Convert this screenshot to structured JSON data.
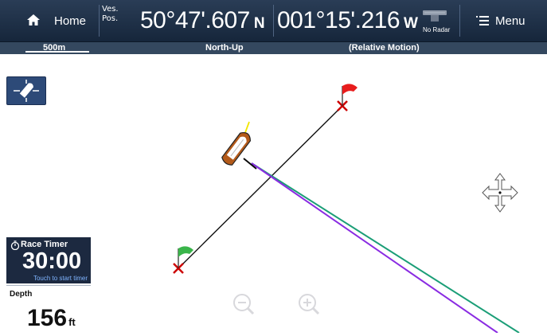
{
  "topbar": {
    "home_label": "Home",
    "ves_pos_label": "Ves.\nPos.",
    "latitude": "50°47'.607",
    "latitude_hemisphere": "N",
    "longitude": "001°15'.216",
    "longitude_hemisphere": "W",
    "radar_label": "No Radar",
    "menu_label": "Menu"
  },
  "statusbar": {
    "scale": "500m",
    "orientation": "North-Up",
    "motion_mode": "(Relative Motion)"
  },
  "race_timer": {
    "title": "Race Timer",
    "value": "30:00",
    "hint": "Touch to start timer"
  },
  "depth": {
    "title": "Depth",
    "value": "156",
    "unit": "ft"
  },
  "colors": {
    "topbar": "#1e2f46",
    "track_green": "#1b9e77",
    "track_purple": "#8a2be2",
    "flag_red": "#e81d1d",
    "flag_green": "#3ab54a",
    "mark_cross": "#cc0000",
    "heading_line": "#f2e600"
  },
  "icons": [
    "home-icon",
    "menu-icon",
    "radar-icon",
    "boat-center-icon",
    "stopwatch-icon",
    "zoom-out-icon",
    "zoom-in-icon",
    "pan-cross-icon",
    "start-line-flag-icon"
  ]
}
